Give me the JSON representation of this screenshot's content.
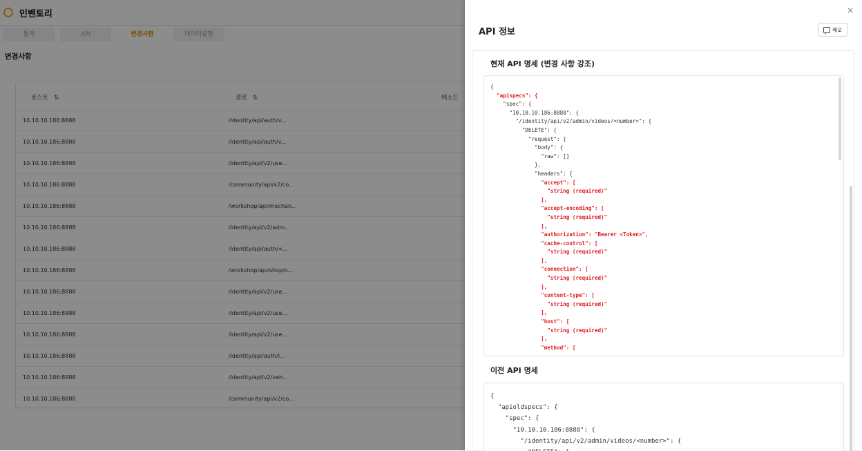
{
  "app": {
    "title": "인벤토리",
    "tabs": [
      {
        "label": "통계"
      },
      {
        "label": "API"
      },
      {
        "label": "변경사항"
      },
      {
        "label": "데이터유형"
      }
    ],
    "active_tab": "변경사항",
    "section_title": "변경사항",
    "table": {
      "columns": {
        "host": "호스트",
        "path": "경로",
        "method": "메소드"
      },
      "sort_icon": "⇅",
      "rows": [
        {
          "host": "10.10.10.186:8888",
          "path": "/identity/api/auth/v..."
        },
        {
          "host": "10.10.10.186:8888",
          "path": "/identity/api/auth/v..."
        },
        {
          "host": "10.10.10.186:8888",
          "path": "/identity/api/v2/use..."
        },
        {
          "host": "10.10.10.186:8888",
          "path": "/community/api/v2/co..."
        },
        {
          "host": "10.10.10.186:8888",
          "path": "/workshop/api/mechan..."
        },
        {
          "host": "10.10.10.186:8888",
          "path": "/identity/api/v2/adm..."
        },
        {
          "host": "10.10.10.186:8888",
          "path": "/identity/api/auth/<..."
        },
        {
          "host": "10.10.10.186:8888",
          "path": "/workshop/api/shop/o..."
        },
        {
          "host": "10.10.10.186:8888",
          "path": "/identity/api/v2/use..."
        },
        {
          "host": "10.10.10.186:8888",
          "path": "/identity/api/v2/use..."
        },
        {
          "host": "10.10.10.186:8888",
          "path": "/identity/api/v2/use..."
        },
        {
          "host": "10.10.10.186:8888",
          "path": "/identity/api/auth/l..."
        },
        {
          "host": "10.10.10.186:8888",
          "path": "/identity/api/v2/veh..."
        },
        {
          "host": "10.10.10.186:8888",
          "path": "/community/api/v2/co..."
        }
      ]
    }
  },
  "drawer": {
    "title": "API 정보",
    "close_label": "×",
    "memo_label": "메모",
    "current_heading": "현재 API 명세 (변경 사항 강조)",
    "previous_heading": "이전 API 명세",
    "current_spec_lines": [
      {
        "text": "{",
        "hl": false
      },
      {
        "text": "  \"apispecs\": {",
        "hl": true
      },
      {
        "text": "    \"spec\": {",
        "hl": false
      },
      {
        "text": "      \"10.10.10.186:8888\": {",
        "hl": false
      },
      {
        "text": "        \"/identity/api/v2/admin/videos/<number>\": {",
        "hl": false
      },
      {
        "text": "          \"DELETE\": {",
        "hl": false
      },
      {
        "text": "            \"request\": {",
        "hl": false
      },
      {
        "text": "              \"body\": {",
        "hl": false
      },
      {
        "text": "                \"raw\": []",
        "hl": false
      },
      {
        "text": "              },",
        "hl": false
      },
      {
        "text": "              \"headers\": {",
        "hl": false
      },
      {
        "text": "                \"accept\": [",
        "hl": true
      },
      {
        "text": "                  \"string (required)\"",
        "hl": true
      },
      {
        "text": "                ],",
        "hl": true
      },
      {
        "text": "                \"accept-encoding\": [",
        "hl": true
      },
      {
        "text": "                  \"string (required)\"",
        "hl": true
      },
      {
        "text": "                ],",
        "hl": true
      },
      {
        "text": "                \"authorization\": \"Bearer <Token>\",",
        "hl": true
      },
      {
        "text": "                \"cache-control\": [",
        "hl": true
      },
      {
        "text": "                  \"string (required)\"",
        "hl": true
      },
      {
        "text": "                ],",
        "hl": true
      },
      {
        "text": "                \"connection\": [",
        "hl": true
      },
      {
        "text": "                  \"string (required)\"",
        "hl": true
      },
      {
        "text": "                ],",
        "hl": true
      },
      {
        "text": "                \"content-type\": [",
        "hl": true
      },
      {
        "text": "                  \"string (required)\"",
        "hl": true
      },
      {
        "text": "                ],",
        "hl": true
      },
      {
        "text": "                \"host\": [",
        "hl": true
      },
      {
        "text": "                  \"string (required)\"",
        "hl": true
      },
      {
        "text": "                ],",
        "hl": true
      },
      {
        "text": "                \"method\": [",
        "hl": true
      }
    ],
    "previous_spec_lines": [
      "{",
      "  \"apioldspecs\": {",
      "    \"spec\": {",
      "      \"10.10.10.186:8888\": {",
      "        \"/identity/api/v2/admin/videos/<number>\": {",
      "          \"DELETE\": {"
    ]
  },
  "colors": {
    "accent": "#e08a00",
    "highlight": "#e0191f",
    "logo": "#f5a623"
  }
}
